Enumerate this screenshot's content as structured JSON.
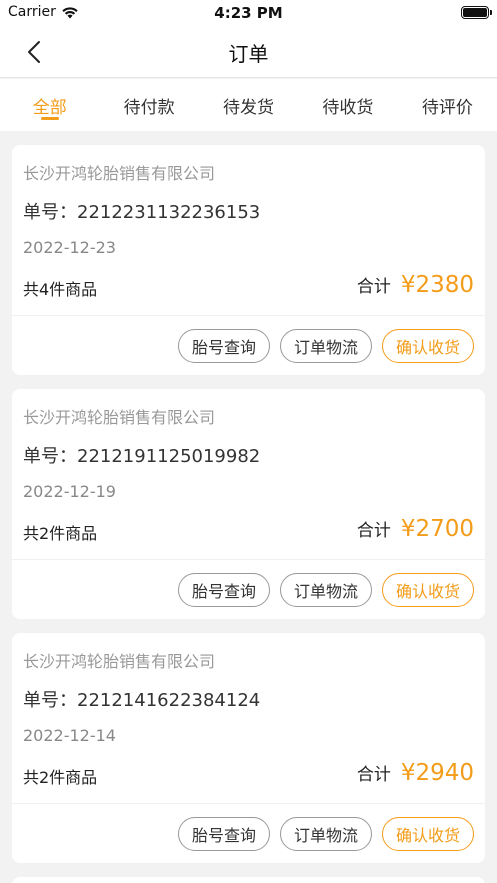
{
  "status_bar": {
    "carrier": "Carrier",
    "time": "4:23 PM"
  },
  "nav": {
    "title": "订单"
  },
  "tabs": [
    {
      "label": "全部",
      "active": true
    },
    {
      "label": "待付款",
      "active": false
    },
    {
      "label": "待发货",
      "active": false
    },
    {
      "label": "待收货",
      "active": false
    },
    {
      "label": "待评价",
      "active": false
    }
  ],
  "colors": {
    "accent": "#f39c1a",
    "background": "#f2f2f2"
  },
  "orders": [
    {
      "company": "长沙开鸿轮胎销售有限公司",
      "order_no": "单号：2212231132236153",
      "date": "2022-12-23",
      "count": "共4件商品",
      "total_label": "合计",
      "amount": "¥2380",
      "actions": [
        "胎号查询",
        "订单物流",
        "确认收货"
      ]
    },
    {
      "company": "长沙开鸿轮胎销售有限公司",
      "order_no": "单号：2212191125019982",
      "date": "2022-12-19",
      "count": "共2件商品",
      "total_label": "合计",
      "amount": "¥2700",
      "actions": [
        "胎号查询",
        "订单物流",
        "确认收货"
      ]
    },
    {
      "company": "长沙开鸿轮胎销售有限公司",
      "order_no": "单号：2212141622384124",
      "date": "2022-12-14",
      "count": "共2件商品",
      "total_label": "合计",
      "amount": "¥2940",
      "actions": [
        "胎号查询",
        "订单物流",
        "确认收货"
      ]
    }
  ]
}
